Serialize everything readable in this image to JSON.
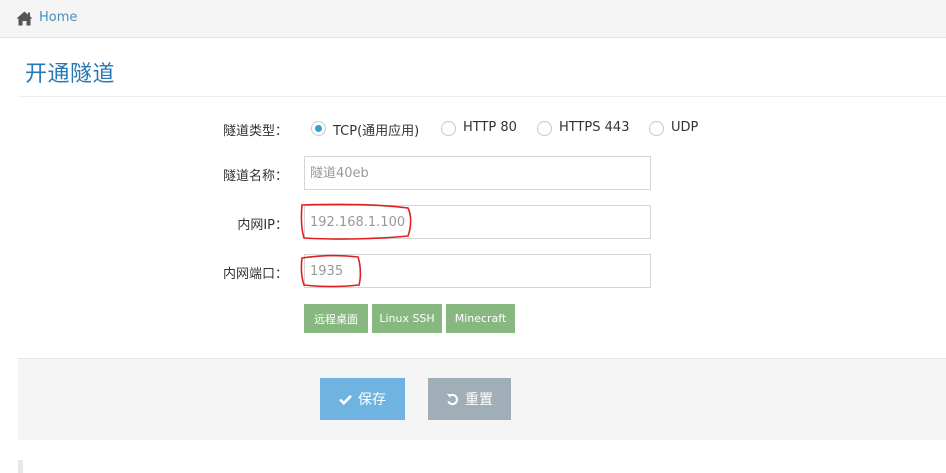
{
  "breadcrumb": {
    "home_label": "Home",
    "icon": "home-icon"
  },
  "page": {
    "title": "开通隧道"
  },
  "form": {
    "tunnel_type": {
      "label": "隧道类型：",
      "options": [
        {
          "label": "TCP(通用应用)",
          "checked": true
        },
        {
          "label": "HTTP 80",
          "checked": false
        },
        {
          "label": "HTTPS 443",
          "checked": false
        },
        {
          "label": "UDP",
          "checked": false
        }
      ]
    },
    "tunnel_name": {
      "label": "隧道名称：",
      "placeholder": "隧道40eb",
      "value": ""
    },
    "local_ip": {
      "label": "内网IP：",
      "placeholder": "192.168.1.100",
      "value": ""
    },
    "local_port": {
      "label": "内网端口：",
      "placeholder": "1935",
      "value": ""
    },
    "presets": [
      "远程桌面",
      "Linux SSH",
      "Minecraft"
    ]
  },
  "actions": {
    "save_label": "保存",
    "reset_label": "重置",
    "save_icon": "check-icon",
    "reset_icon": "undo-icon"
  },
  "colors": {
    "link": "#4c8fbd",
    "title": "#2679b5",
    "radio_checked": "#32a3ce",
    "preset_button": "#87b87f",
    "save_button": "#6fb3e0",
    "reset_button": "#a0aeb8",
    "annotation": "#e02020"
  }
}
